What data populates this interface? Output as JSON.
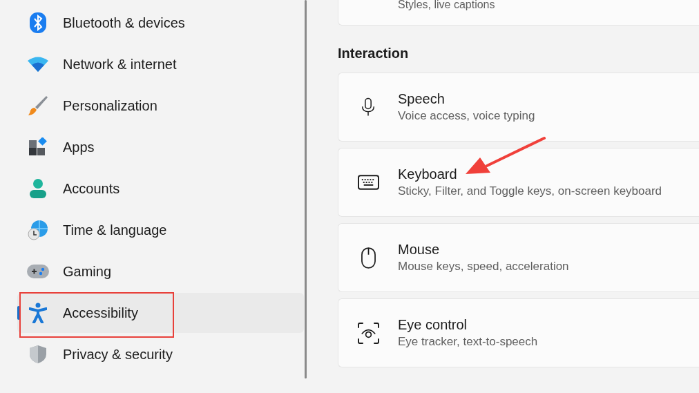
{
  "sidebar": {
    "items": [
      {
        "label": "Bluetooth & devices",
        "selected": false
      },
      {
        "label": "Network & internet",
        "selected": false
      },
      {
        "label": "Personalization",
        "selected": false
      },
      {
        "label": "Apps",
        "selected": false
      },
      {
        "label": "Accounts",
        "selected": false
      },
      {
        "label": "Time & language",
        "selected": false
      },
      {
        "label": "Gaming",
        "selected": false
      },
      {
        "label": "Accessibility",
        "selected": true
      },
      {
        "label": "Privacy & security",
        "selected": false
      }
    ]
  },
  "content": {
    "partial_card": {
      "description": "Styles, live captions"
    },
    "section_title": "Interaction",
    "cards": [
      {
        "title": "Speech",
        "description": "Voice access, voice typing"
      },
      {
        "title": "Keyboard",
        "description": "Sticky, Filter, and Toggle keys, on-screen keyboard"
      },
      {
        "title": "Mouse",
        "description": "Mouse keys, speed, acceleration"
      },
      {
        "title": "Eye control",
        "description": "Eye tracker, text-to-speech"
      }
    ]
  }
}
